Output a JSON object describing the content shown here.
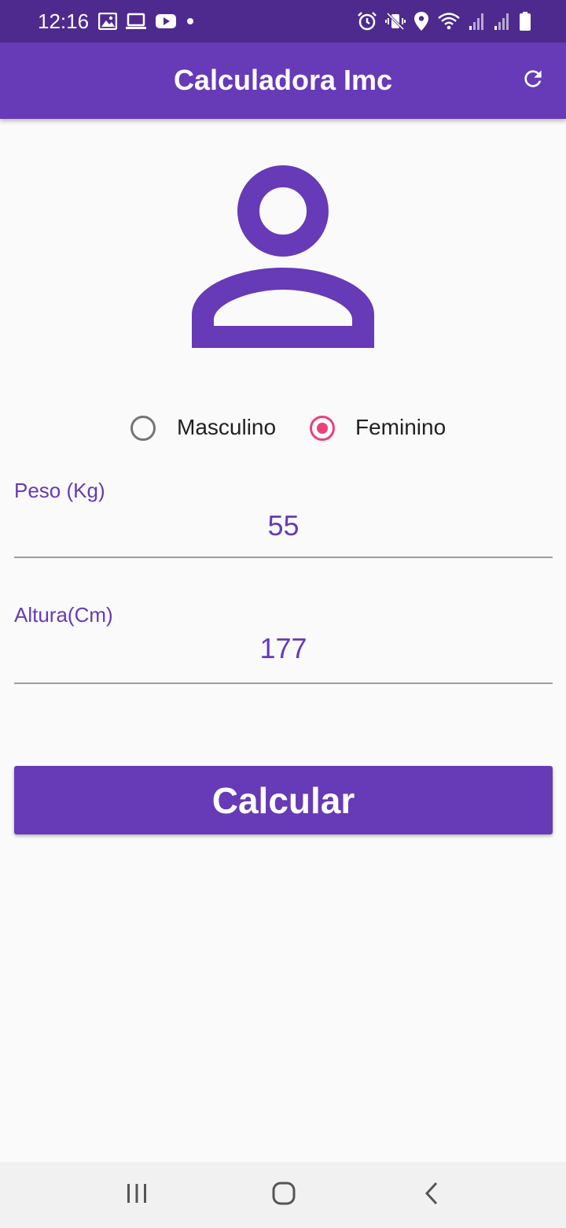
{
  "status_bar": {
    "time": "12:16",
    "left_icons": [
      "image-icon",
      "laptop-icon",
      "youtube-icon",
      "dot-icon"
    ],
    "right_icons": [
      "alarm-icon",
      "vibrate-icon",
      "location-icon",
      "wifi-icon",
      "signal-icon",
      "signal-icon",
      "battery-icon"
    ]
  },
  "app_bar": {
    "title": "Calculadora Imc",
    "action_icon": "refresh-icon"
  },
  "gender": {
    "options": [
      {
        "label": "Masculino",
        "selected": false
      },
      {
        "label": "Feminino",
        "selected": true
      }
    ]
  },
  "form": {
    "peso": {
      "label": "Peso (Kg)",
      "value": "55"
    },
    "altura": {
      "label": "Altura(Cm)",
      "value": "177"
    }
  },
  "calculate_button": {
    "label": "Calcular"
  },
  "colors": {
    "primary": "#673ab7",
    "status_bar": "#4e2a8e",
    "accent": "#ec407a",
    "background": "#fafafa"
  }
}
